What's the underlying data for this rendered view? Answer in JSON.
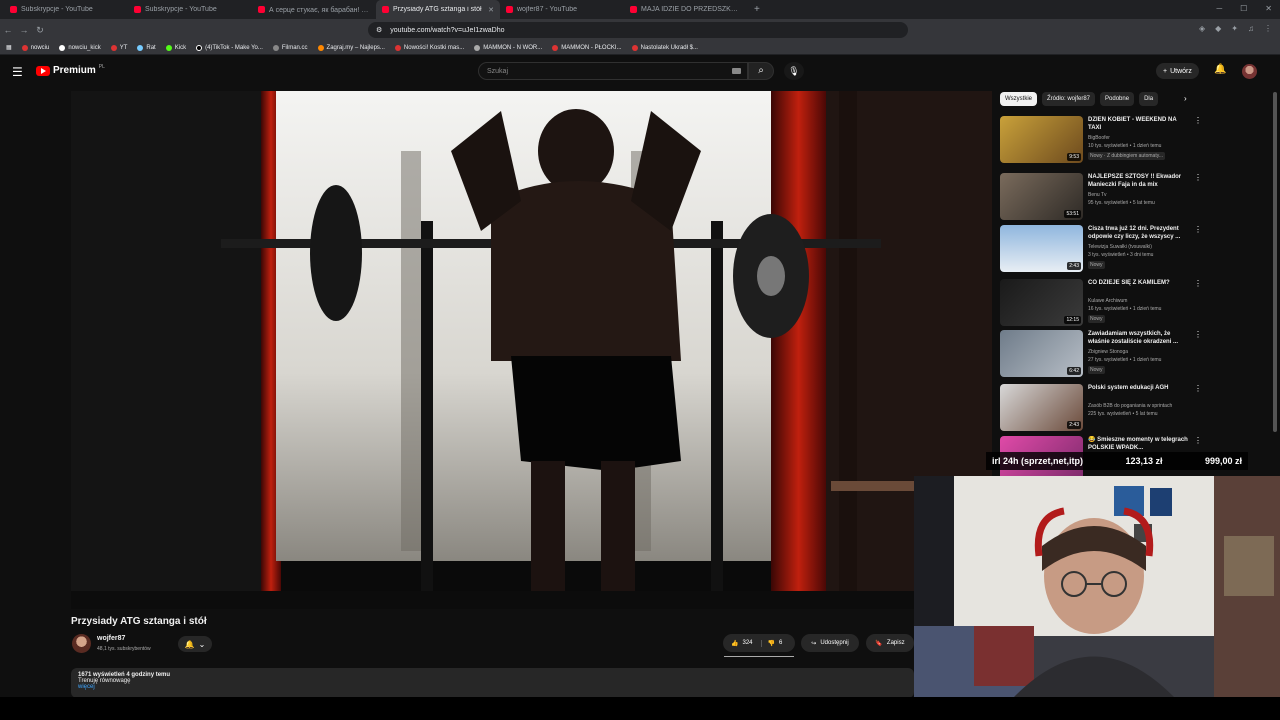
{
  "browser": {
    "tabs": [
      {
        "title": "Subskrypcje - YouTube",
        "active": false
      },
      {
        "title": "Subskrypcje - YouTube",
        "active": false
      },
      {
        "title": "А серце стукає, як барабан! 💔 Пр...",
        "active": false
      },
      {
        "title": "Przysiady ATG sztanga i stół",
        "active": true
      },
      {
        "title": "wojfer87 - YouTube",
        "active": false
      },
      {
        "title": "MAJA IDZIE DO PRZEDSZKOLA! - Yo...",
        "active": false
      }
    ],
    "new_tab": "+",
    "url": "youtube.com/watch?v=uJeI1zwaDho",
    "bookmarks": [
      "nowciu",
      "nowciu_kick",
      "YT",
      "Rat",
      "Kick",
      "(4)TikTok - Make Yo...",
      "Filman.cc",
      "Zagraj.my – Najleps...",
      "Nowości! Kostki mas...",
      "MAMMON - N WOR...",
      "MAMMON - PŁOCKI...",
      "Nastolatek Ukradł $..."
    ]
  },
  "youtube": {
    "logo_text": "Premium",
    "logo_region": "PL",
    "search_placeholder": "Szukaj",
    "create_label": "Utwórz"
  },
  "video": {
    "title": "Przysiady ATG sztanga i stół",
    "channel": "wojfer87",
    "subscribers": "48,1 tys. subskrybentów",
    "likes": "324",
    "dislikes": "6",
    "share_label": "Udostępnij",
    "save_label": "Zapisz",
    "views_time": "1671 wyświetleń  4 godziny temu",
    "description_line1": "Trenuję równowagę",
    "description_more": "więcej"
  },
  "chips": [
    "Wszystkie",
    "Źródło: wojfer87",
    "Podobne",
    "Dla"
  ],
  "recommendations": [
    {
      "title": "DZIEŃ KOBIET - WEEKEND NA TAXI",
      "channel": "BigBoofer",
      "views": "10 tys. wyświetleń • 1 dzień temu",
      "badges": [
        "Nowy",
        "Z dubbingiem automaty..."
      ],
      "duration": "9:53",
      "thumb_colors": [
        "#c9a13a",
        "#6d4a1e"
      ]
    },
    {
      "title": "NAJLEPSZE SZTOSY !! Ekwador Manieczki Faja in da mix",
      "channel": "Benu Tv",
      "views": "95 tys. wyświetleń • 5 lat temu",
      "badges": [],
      "duration": "53:51",
      "thumb_colors": [
        "#7a6b5c",
        "#2e2a26"
      ]
    },
    {
      "title": "Cisza trwa już 12 dni. Prezydent odpowie czy liczy, że wszyscy ...",
      "channel": "Telewizja Suwałki (tvsuwalki)",
      "views": "3 tys. wyświetleń • 3 dni temu",
      "badges": [
        "Nowy"
      ],
      "duration": "2:43",
      "thumb_colors": [
        "#8fb6de",
        "#e8eef4"
      ]
    },
    {
      "title": "CO DZIEJE SIĘ Z KAMILEM?",
      "channel": "Kulawe Archiwum",
      "views": "16 tys. wyświetleń • 1 dzień temu",
      "badges": [
        "Nowy"
      ],
      "duration": "12:15",
      "thumb_colors": [
        "#1a1a1a",
        "#3b3b3b"
      ]
    },
    {
      "title": "Zawiadamiam wszystkich, że właśnie zostaliście okradzeni ...",
      "channel": "Zbigniew Stonoga",
      "views": "27 tys. wyświetleń • 1 dzień temu",
      "badges": [
        "Nowy"
      ],
      "duration": "6:42",
      "thumb_colors": [
        "#6f7c8a",
        "#b7bec6"
      ]
    },
    {
      "title": "Polski system edukacji AGH",
      "channel": "Zasób B2B do poganiania w sprintach",
      "views": "225 tys. wyświetleń • 5 lat temu",
      "badges": [],
      "duration": "2:43",
      "thumb_colors": [
        "#d8d8d8",
        "#6b4a3a"
      ]
    },
    {
      "title": "😂 Śmieszne momenty w telegrach POLSKIE WPADK...",
      "channel": "",
      "views": "",
      "badges": [],
      "duration": "",
      "thumb_colors": [
        "#e04aa8",
        "#7a2a6a"
      ]
    }
  ],
  "overlay": {
    "label": "irl 24h (sprzet,net,itp)",
    "current": "123,13 zł",
    "goal": "999,00 zł"
  }
}
